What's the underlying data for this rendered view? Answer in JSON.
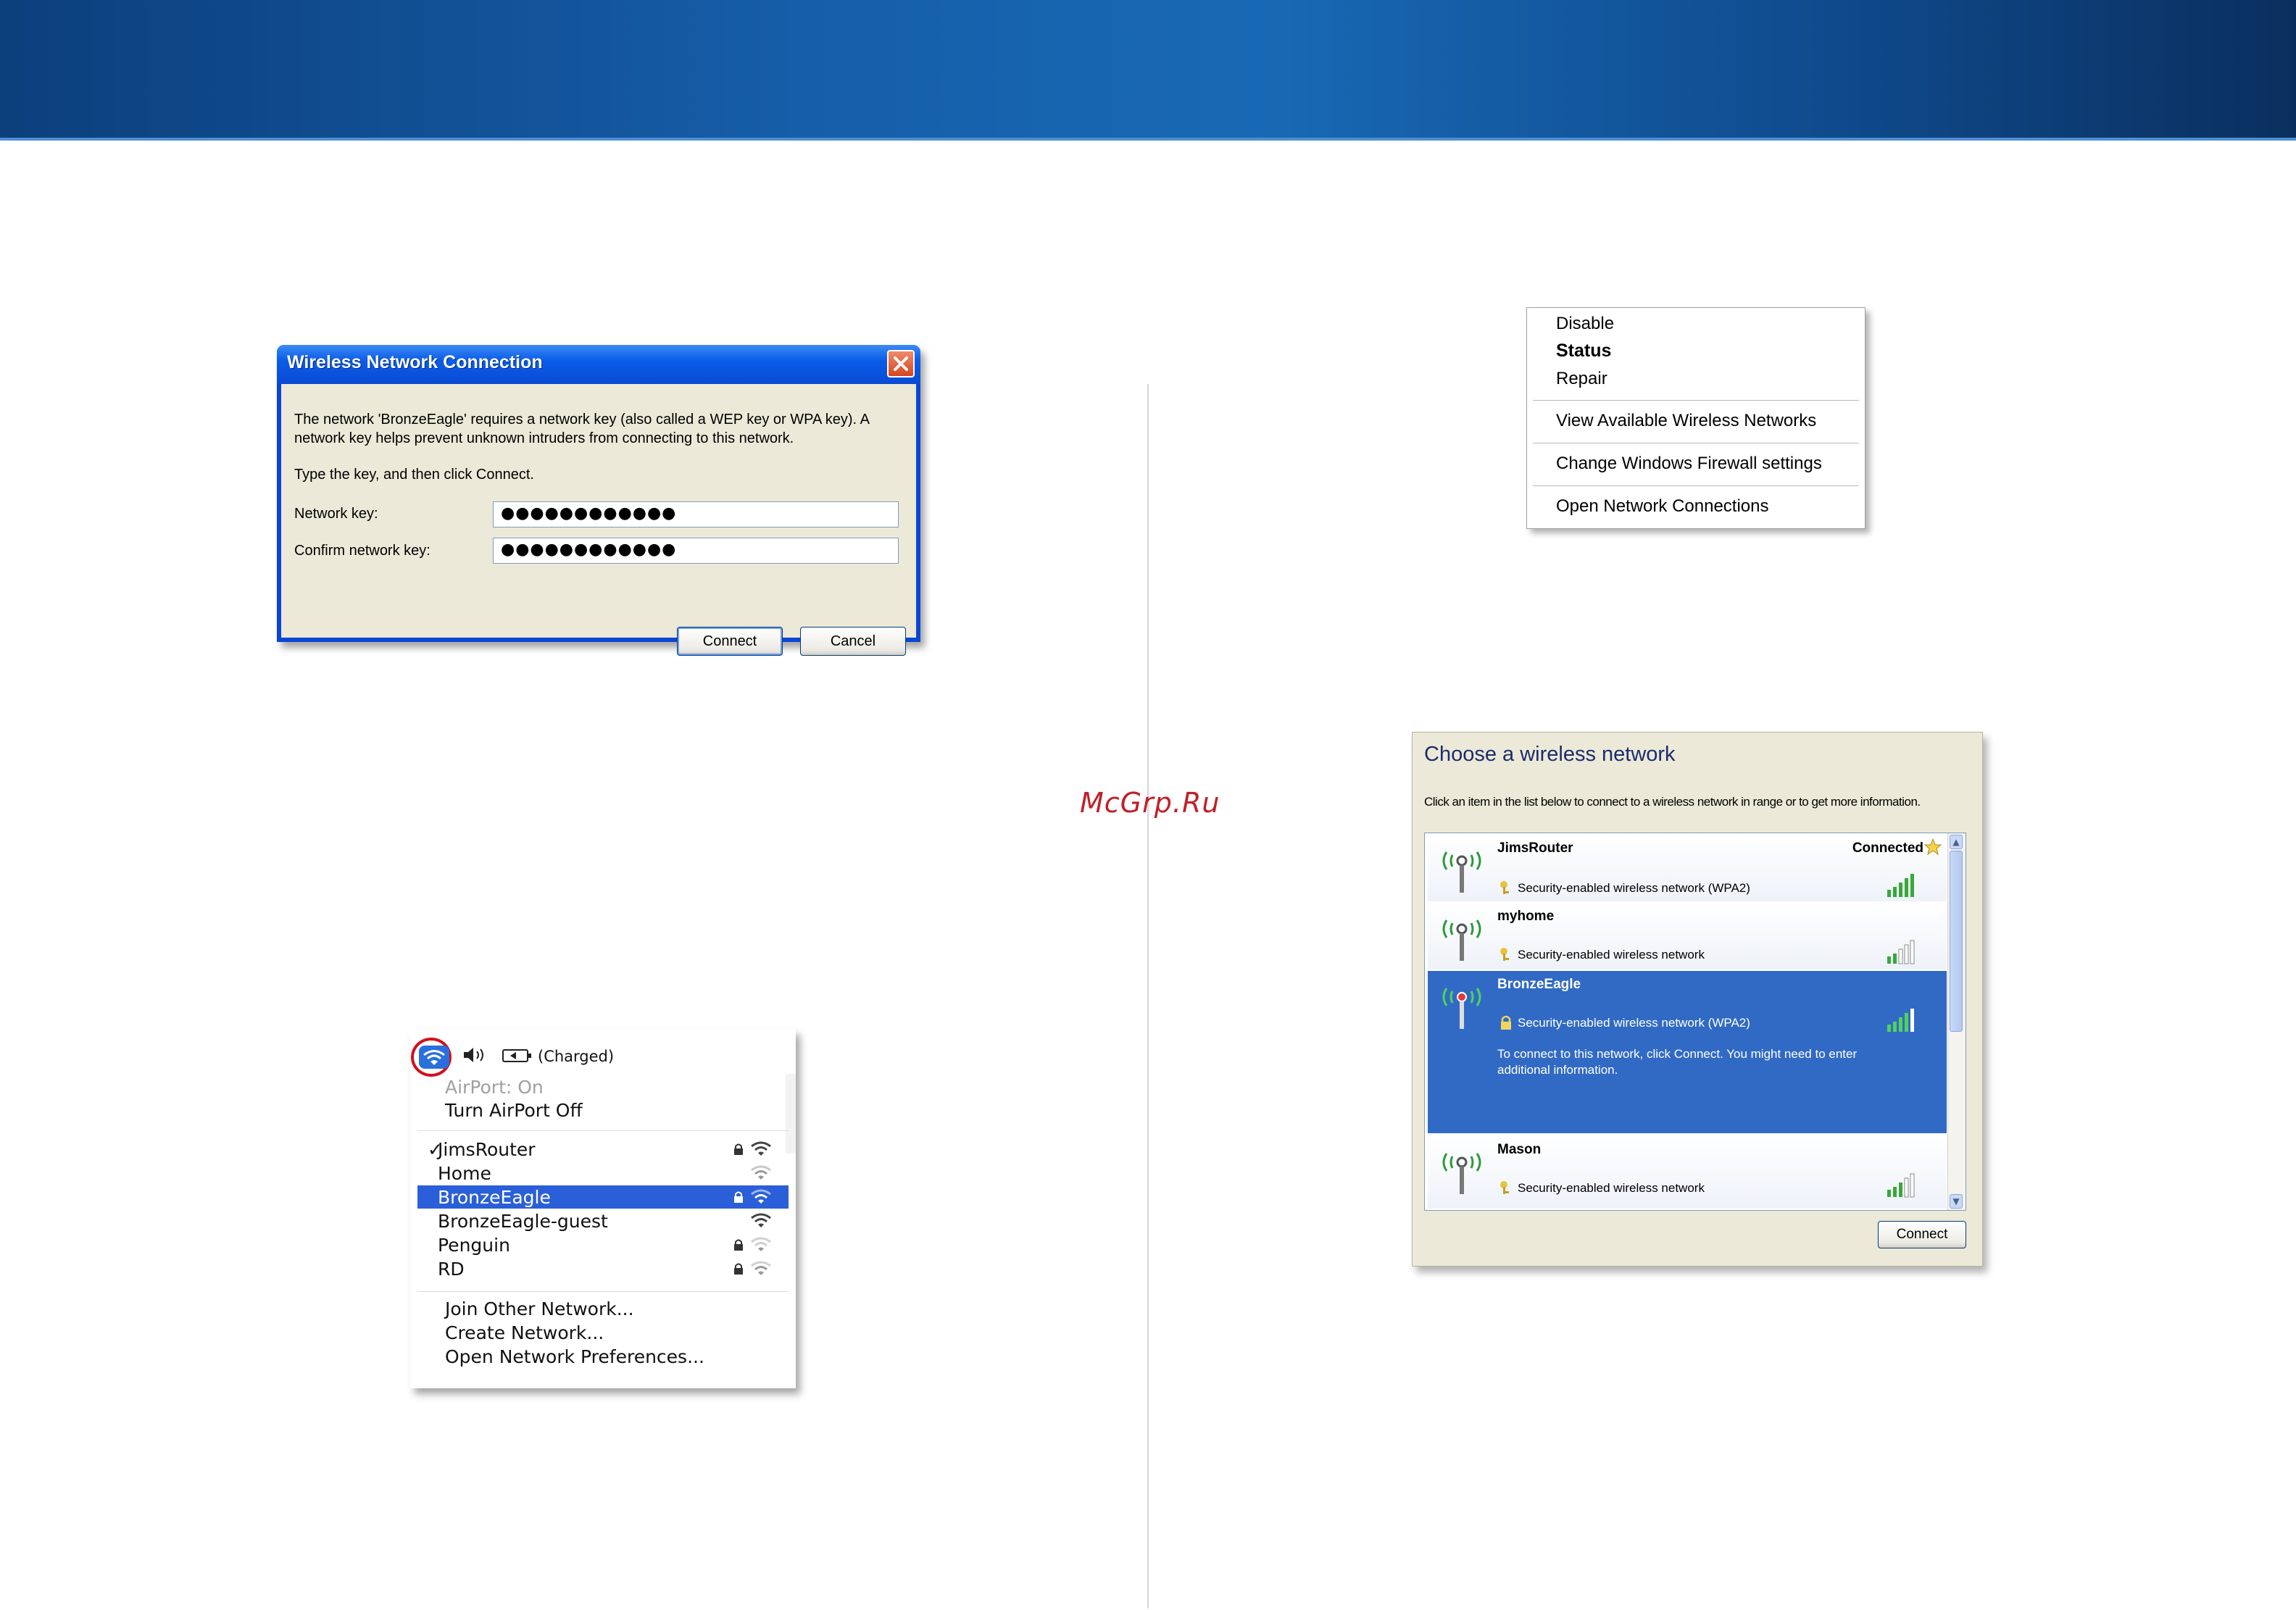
{
  "watermark": "McGrp.Ru",
  "xp_dialog": {
    "title": "Wireless Network Connection",
    "message_line1": "The network 'BronzeEagle' requires a network key (also called a WEP key or WPA key). A",
    "message_line2": "network key helps prevent unknown intruders from connecting to this network.",
    "instruction": "Type the key, and then click Connect.",
    "network_key_label": "Network key:",
    "network_key_value": "●●●●●●●●●●●●",
    "confirm_key_label": "Confirm network key:",
    "confirm_key_value": "●●●●●●●●●●●●",
    "connect_label": "Connect",
    "cancel_label": "Cancel"
  },
  "context_menu": {
    "items": [
      "Disable",
      "Status",
      "Repair",
      "View Available Wireless Networks",
      "Change Windows Firewall settings",
      "Open Network Connections"
    ]
  },
  "mac_menu": {
    "battery_status": "(Charged)",
    "airport_status": "AirPort: On",
    "turn_off": "Turn AirPort Off",
    "networks": [
      {
        "name": "JimsRouter",
        "checked": true,
        "locked": true
      },
      {
        "name": "Home",
        "checked": false,
        "locked": false
      },
      {
        "name": "BronzeEagle",
        "checked": false,
        "locked": true,
        "selected": true
      },
      {
        "name": "BronzeEagle-guest",
        "checked": false,
        "locked": false
      },
      {
        "name": "Penguin",
        "checked": false,
        "locked": true
      },
      {
        "name": "RD",
        "checked": false,
        "locked": true
      }
    ],
    "checkmark": "✓",
    "join_other": "Join Other Network...",
    "create_network": "Create Network...",
    "open_prefs": "Open Network Preferences..."
  },
  "choose_network": {
    "title": "Choose a wireless network",
    "description": "Click an item in the list below to connect to a wireless network in range or to get more information.",
    "networks": [
      {
        "name": "JimsRouter",
        "status": "Connected",
        "security": "Security-enabled wireless network (WPA2)"
      },
      {
        "name": "myhome",
        "status": "",
        "security": "Security-enabled wireless network"
      },
      {
        "name": "BronzeEagle",
        "status": "",
        "security": "Security-enabled wireless network (WPA2)",
        "hint": "To connect to this network, click Connect. You might need to enter additional information."
      },
      {
        "name": "Mason",
        "status": "",
        "security": "Security-enabled wireless network"
      }
    ],
    "connect_label": "Connect"
  },
  "colors": {
    "header_blue": "#1869b5",
    "xp_title_blue": "#0a4bd4",
    "selection_blue": "#316ac5",
    "mac_selection": "#2b5fd9",
    "watermark_red": "#c0202a"
  }
}
